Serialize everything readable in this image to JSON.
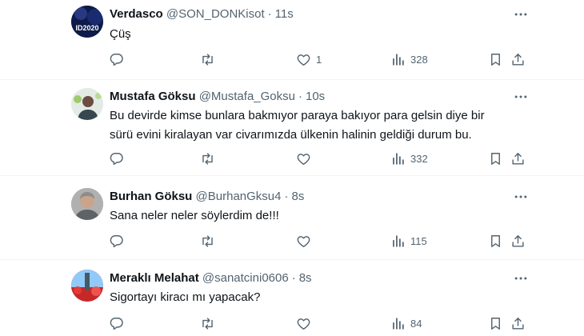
{
  "tweets": [
    {
      "name": "Verdasco",
      "handle": "@SON_DONKisot",
      "time": "11s",
      "text": "Çüş",
      "avatar_text": "ID2020",
      "likes": "1",
      "views": "328"
    },
    {
      "name": "Mustafa Göksu",
      "handle": "@Mustafa_Goksu",
      "time": "10s",
      "text": "Bu devirde kimse bunlara bakmıyor paraya bakıyor para gelsin diye bir sürü evini kiralayan var civarımızda ülkenin halinin geldiği durum bu.",
      "views": "332"
    },
    {
      "name": "Burhan Göksu",
      "handle": "@BurhanGksu4",
      "time": "8s",
      "text": "Sana neler neler söylerdim de!!!",
      "views": "115"
    },
    {
      "name": "Meraklı Melahat",
      "handle": "@sanatcini0606",
      "time": "8s",
      "text": "Sigortayı kiracı mı yapacak?",
      "views": "84"
    }
  ],
  "colors": {
    "text": "#0f1419",
    "secondary": "#536471",
    "divider": "#eff3f4"
  },
  "icons": [
    "more-icon",
    "reply-icon",
    "retweet-icon",
    "like-icon",
    "views-icon",
    "bookmark-icon",
    "share-icon"
  ]
}
